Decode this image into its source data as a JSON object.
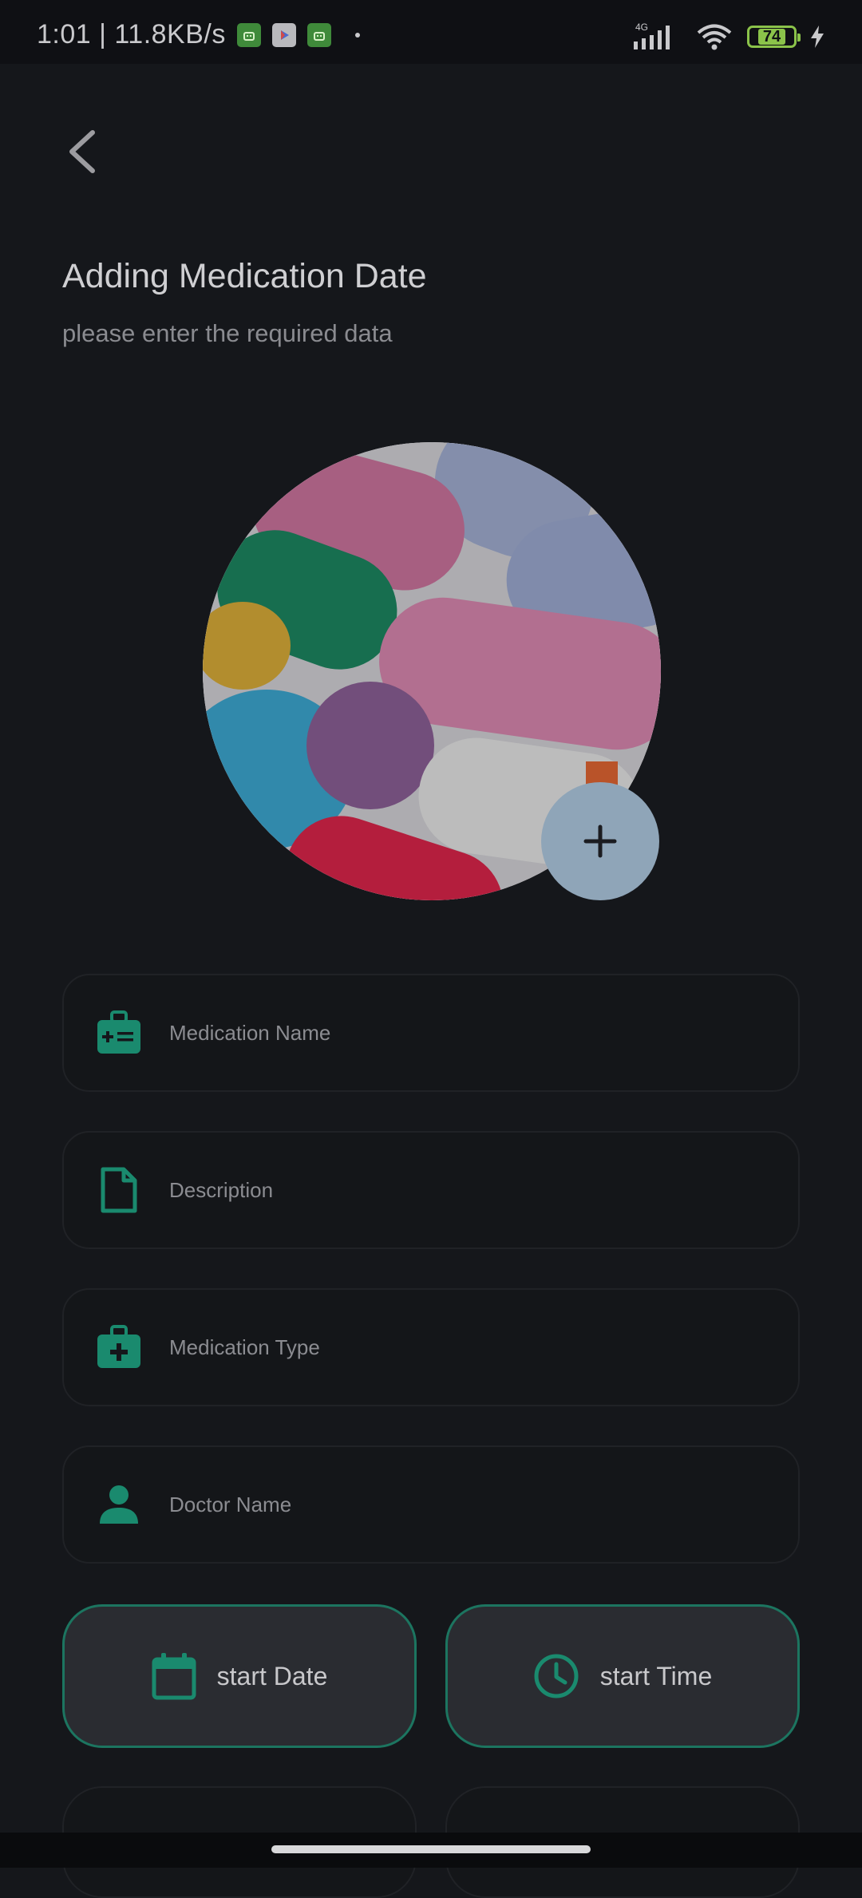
{
  "status_bar": {
    "time_speed": "1:01 | 11.8KB/s",
    "network_label": "4G",
    "battery_level": "74",
    "icons": [
      "android-notification-icon",
      "play-store-icon",
      "android-notification-icon",
      "notification-dot",
      "signal-icon",
      "wifi-icon",
      "battery-icon",
      "charging-icon"
    ]
  },
  "header": {
    "back_icon": "chevron-left-icon",
    "title": "Adding Medication Date",
    "subtitle": "please enter the required data"
  },
  "image": {
    "add_icon": "plus-icon",
    "overlay_color": "#8fa5b8"
  },
  "form": {
    "fields": [
      {
        "placeholder": "Medication Name",
        "icon": "medical-bag-icon",
        "value": ""
      },
      {
        "placeholder": "Description",
        "icon": "document-icon",
        "value": ""
      },
      {
        "placeholder": "Medication Type",
        "icon": "first-aid-kit-icon",
        "value": ""
      },
      {
        "placeholder": "Doctor Name",
        "icon": "person-icon",
        "value": ""
      }
    ],
    "start_date_label": "start Date",
    "start_time_label": "start Time"
  },
  "colors": {
    "background": "#15171b",
    "accent": "#1a8a6e",
    "border_accent": "#1c7560"
  }
}
